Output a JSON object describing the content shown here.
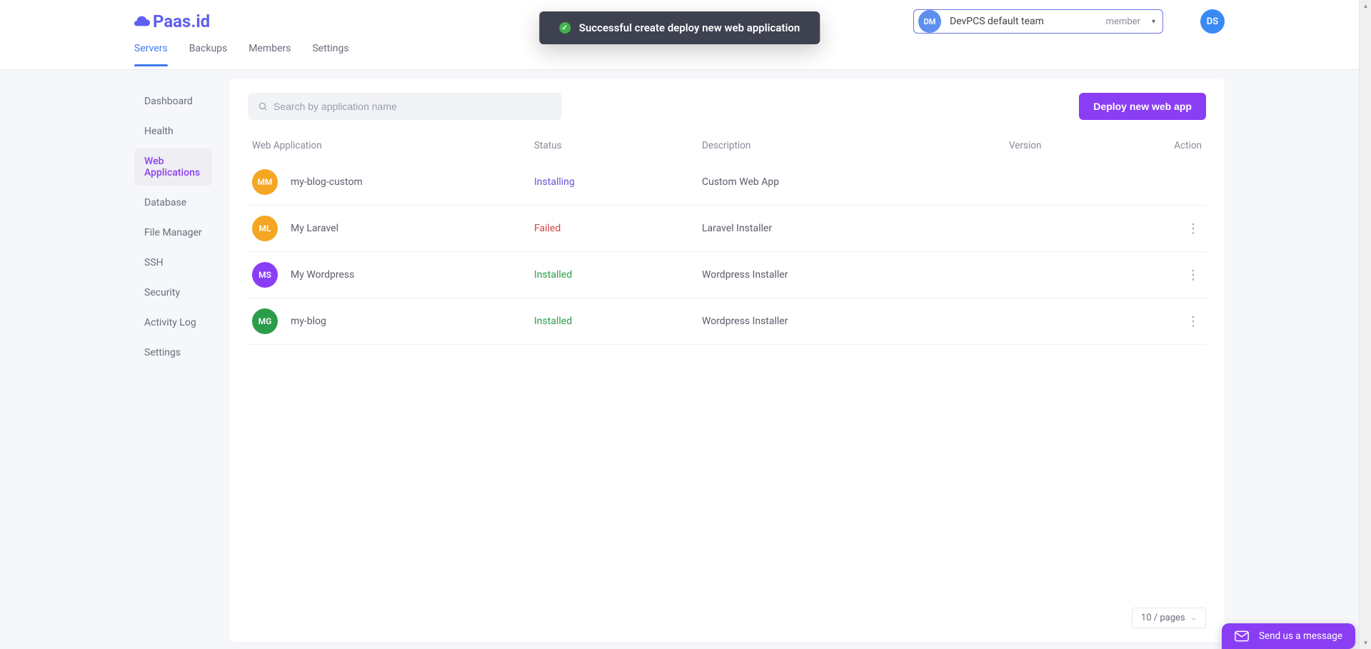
{
  "brand": {
    "name": "Paas.id"
  },
  "toast": {
    "message": "Successful create deploy new web application"
  },
  "team": {
    "avatar_initials": "DM",
    "name": "DevPCS default team",
    "role": "member"
  },
  "user": {
    "avatar_initials": "DS"
  },
  "topnav": {
    "items": [
      {
        "label": "Servers",
        "active": true
      },
      {
        "label": "Backups",
        "active": false
      },
      {
        "label": "Members",
        "active": false
      },
      {
        "label": "Settings",
        "active": false
      }
    ]
  },
  "sidebar": {
    "items": [
      {
        "label": "Dashboard",
        "active": false
      },
      {
        "label": "Health",
        "active": false
      },
      {
        "label": "Web Applications",
        "active": true
      },
      {
        "label": "Database",
        "active": false
      },
      {
        "label": "File Manager",
        "active": false
      },
      {
        "label": "SSH",
        "active": false
      },
      {
        "label": "Security",
        "active": false
      },
      {
        "label": "Activity Log",
        "active": false
      },
      {
        "label": "Settings",
        "active": false
      }
    ]
  },
  "search": {
    "placeholder": "Search by application name",
    "value": ""
  },
  "deploy_button": "Deploy new web app",
  "table": {
    "headers": {
      "app": "Web Application",
      "status": "Status",
      "description": "Description",
      "version": "Version",
      "action": "Action"
    },
    "rows": [
      {
        "initials": "MM",
        "avatar_color": "#f5a623",
        "name": "my-blog-custom",
        "status": "Installing",
        "status_class": "st-installing",
        "description": "Custom Web App",
        "has_actions": false
      },
      {
        "initials": "ML",
        "avatar_color": "#f5a623",
        "name": "My Laravel",
        "status": "Failed",
        "status_class": "st-failed",
        "description": "Laravel Installer",
        "has_actions": true
      },
      {
        "initials": "MS",
        "avatar_color": "#8a3ef4",
        "name": "My Wordpress",
        "status": "Installed",
        "status_class": "st-installed",
        "description": "Wordpress Installer",
        "has_actions": true
      },
      {
        "initials": "MG",
        "avatar_color": "#2b9d4a",
        "name": "my-blog",
        "status": "Installed",
        "status_class": "st-installed",
        "description": "Wordpress Installer",
        "has_actions": true
      }
    ]
  },
  "pagination": {
    "page_size_label": "10 / pages"
  },
  "chat": {
    "label": "Send us a message"
  }
}
